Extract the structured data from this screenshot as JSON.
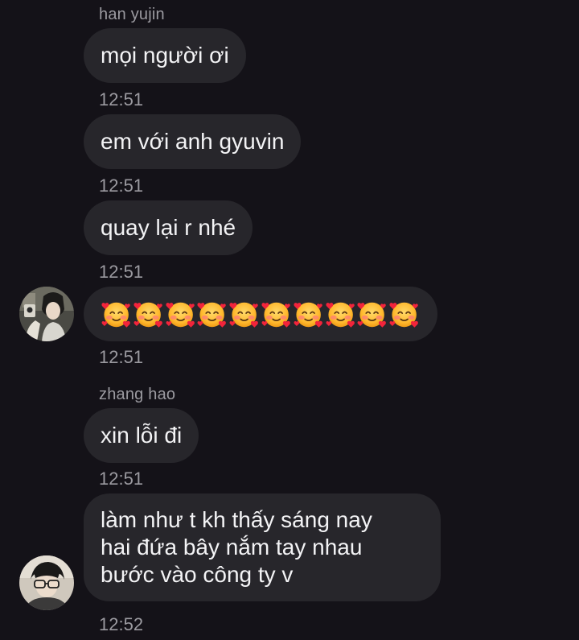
{
  "messages": [
    {
      "sender": "han yujin",
      "text": "mọi người ơi",
      "time": "12:51"
    },
    {
      "text": "em với anh gyuvin",
      "time": "12:51"
    },
    {
      "text": "quay lại r nhé",
      "time": "12:51"
    },
    {
      "emoji": "smiling-face-with-hearts",
      "emoji_count": 10,
      "time": "12:51"
    },
    {
      "sender": "zhang hao",
      "text": "xin lỗi đi",
      "time": "12:51"
    },
    {
      "lines": [
        "làm như t kh thấy sáng nay",
        "hai đứa bây nắm tay nhau",
        "bước vào công ty v"
      ],
      "time": "12:52"
    }
  ],
  "colors": {
    "background": "#141218",
    "bubble": "#27262b",
    "meta_text": "#9b9aa0",
    "message_text": "#f3f3f5"
  },
  "icons": {
    "emoji": "smiling-face-with-hearts",
    "avatars": [
      "avatar-han-yujin",
      "avatar-zhang-hao"
    ]
  }
}
